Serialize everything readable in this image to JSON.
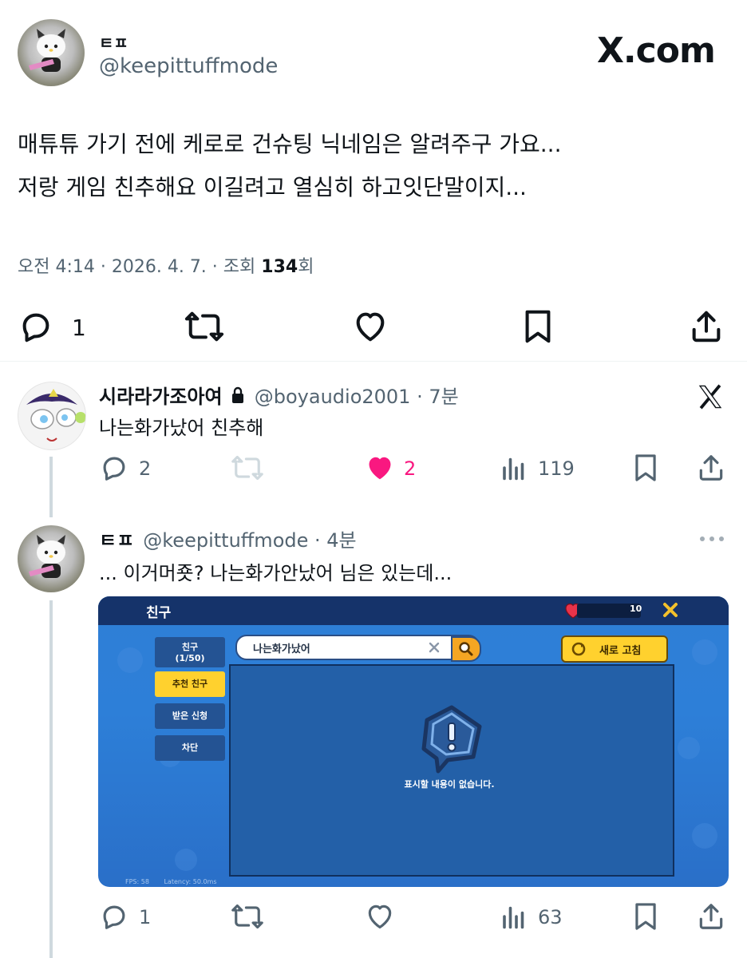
{
  "main_tweet": {
    "display_name": "ㅌㅍ",
    "handle": "@keepittuffmode",
    "brand": "X.com",
    "lines": [
      "매튜튜 가기 전에 케로로 건슈팅 닉네임은 알려주구 가요...",
      "저랑 게임 친추해요 이길려고 열심히 하고잇단말이지..."
    ],
    "meta_prefix": "오전 4:14 · 2026. 4. 7. · 조회 ",
    "views": "134",
    "meta_suffix": "회",
    "reply_count": "1"
  },
  "reply1": {
    "display_name": "시라라가조아여",
    "handle": "@boyaudio2001 · 7분",
    "text": "나는화가났어 친추해",
    "reply_count": "2",
    "like_count": "2",
    "view_count": "119"
  },
  "reply2": {
    "display_name": "ㅌㅍ",
    "handle": "@keepittuffmode · 4분",
    "text": "... 이거머죳? 나는화가안났어 님은 있는데...",
    "reply_count": "1",
    "view_count": "63"
  },
  "game": {
    "title": "친구",
    "heart_count": "10",
    "friends_label": "친구",
    "friends_count": "(1/50)",
    "tab_recommended": "추천 친구",
    "tab_received": "받은 신청",
    "tab_blocked": "차단",
    "search_value": "나는화가났어",
    "refresh_label": "새로 고침",
    "empty_message": "표시할 내용이 없습니다.",
    "fps": "FPS: 58",
    "latency": "Latency: 50.0ms"
  },
  "colors": {
    "text": "#0f1419",
    "secondary": "#536471",
    "like_pink": "#f91880",
    "game_yellow": "#ffd12e"
  }
}
